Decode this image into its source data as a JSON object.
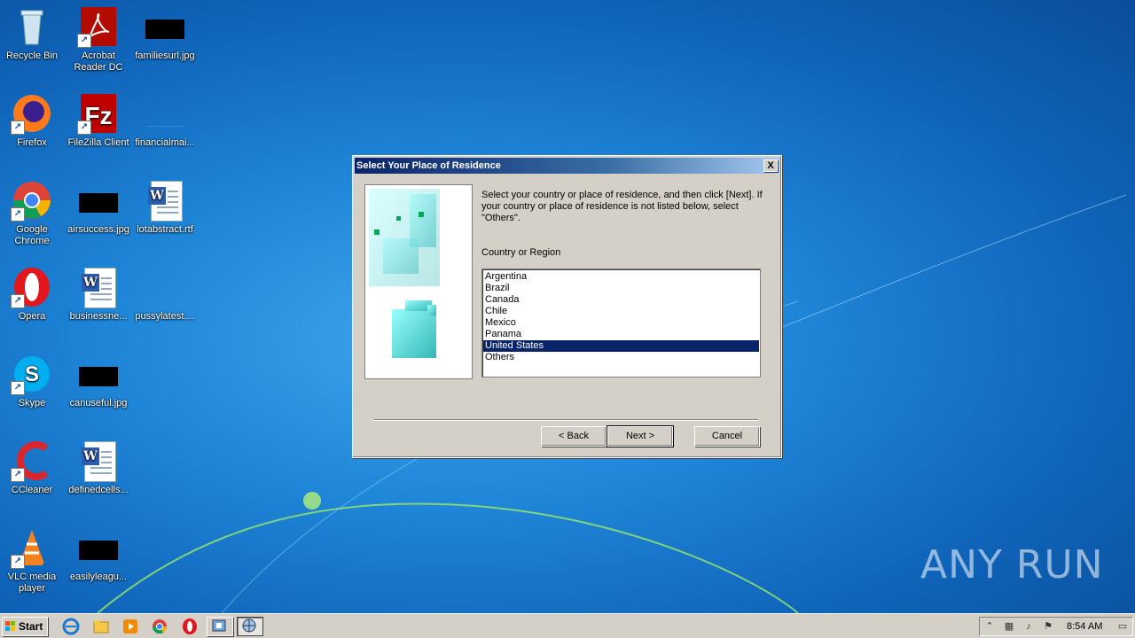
{
  "desktop": {
    "icons": [
      {
        "label": "Recycle Bin"
      },
      {
        "label": "Acrobat Reader DC"
      },
      {
        "label": "familiesurl.jpg"
      },
      {
        "label": "Firefox"
      },
      {
        "label": "FileZilla Client"
      },
      {
        "label": "financialmai..."
      },
      {
        "label": "Google Chrome"
      },
      {
        "label": "airsuccess.jpg"
      },
      {
        "label": "lotabstract.rtf"
      },
      {
        "label": "Opera"
      },
      {
        "label": "businessne..."
      },
      {
        "label": "pussylatest...."
      },
      {
        "label": "Skype"
      },
      {
        "label": "canuseful.jpg"
      },
      {
        "label": "CCleaner"
      },
      {
        "label": "definedcells..."
      },
      {
        "label": "VLC media player"
      },
      {
        "label": "easilyleagu..."
      }
    ],
    "watermark": "ANY RUN"
  },
  "dialog": {
    "title": "Select Your Place of Residence",
    "close_label": "X",
    "description": "Select your country or place of residence, and then click [Next]. If your country or place of residence is not listed below, select \"Others\".",
    "list_label": "Country or Region",
    "countries": [
      "Argentina",
      "Brazil",
      "Canada",
      "Chile",
      "Mexico",
      "Panama",
      "United States",
      "Others"
    ],
    "selected": "United States",
    "buttons": {
      "back": "< Back",
      "next": "Next >",
      "cancel": "Cancel"
    }
  },
  "taskbar": {
    "start_label": "Start",
    "clock": "8:54 AM"
  },
  "colors": {
    "selection": "#0a246a",
    "titlebar": "#0a246a",
    "dialog_bg": "#d4d0c8"
  }
}
